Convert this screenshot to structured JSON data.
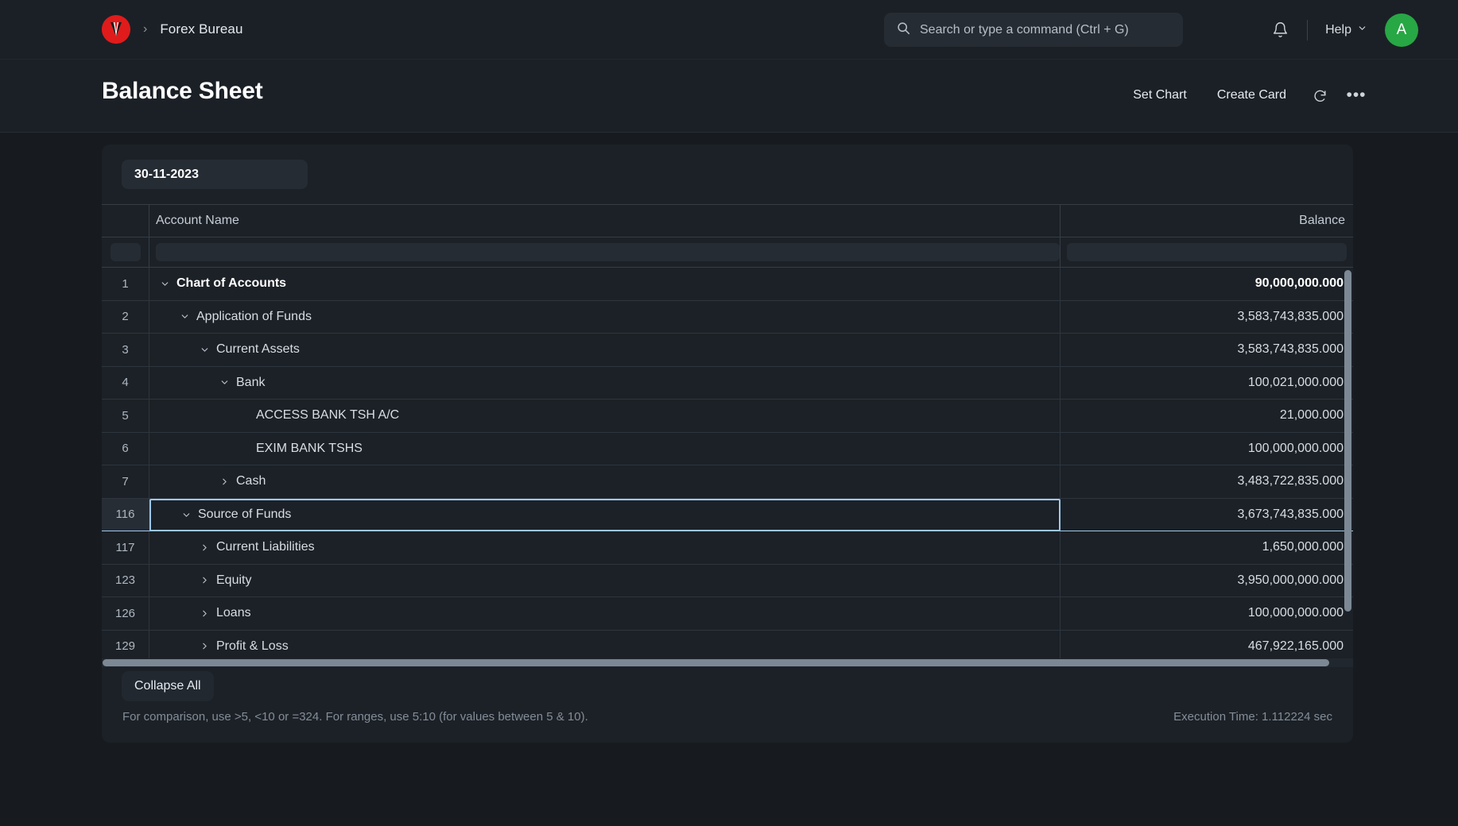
{
  "navbar": {
    "logo_icon": "vee-logo-icon",
    "breadcrumb_separator": "›",
    "breadcrumb_label": "Forex Bureau",
    "search": {
      "icon": "search-icon",
      "placeholder": "Search or type a command (Ctrl + G)",
      "value": ""
    },
    "bell_icon": "notification-bell-icon",
    "help_label": "Help",
    "help_chevron_icon": "chevron-down-icon",
    "avatar_initial": "A",
    "avatar_color": "#28a745"
  },
  "pagehead": {
    "title": "Balance Sheet",
    "actions": {
      "set_chart": "Set Chart",
      "create_card": "Create Card",
      "refresh_icon": "refresh-icon",
      "more_icon": "ellipsis-icon",
      "more_label": "•••"
    }
  },
  "filters": {
    "date_value": "30-11-2023"
  },
  "grid": {
    "columns": {
      "index": "",
      "account_name": "Account Name",
      "balance": "Balance"
    },
    "filter_row": {
      "account_name_value": "",
      "balance_value": ""
    },
    "rows": [
      {
        "idx": "1",
        "indent": 0,
        "chevron": "chevron-down-icon",
        "label": "Chart of Accounts",
        "balance": "90,000,000.000",
        "bold": true,
        "selected": false
      },
      {
        "idx": "2",
        "indent": 1,
        "chevron": "chevron-down-icon",
        "label": "Application of Funds",
        "balance": "3,583,743,835.000",
        "bold": false,
        "selected": false
      },
      {
        "idx": "3",
        "indent": 2,
        "chevron": "chevron-down-icon",
        "label": "Current Assets",
        "balance": "3,583,743,835.000",
        "bold": false,
        "selected": false
      },
      {
        "idx": "4",
        "indent": 3,
        "chevron": "chevron-down-icon",
        "label": "Bank",
        "balance": "100,021,000.000",
        "bold": false,
        "selected": false
      },
      {
        "idx": "5",
        "indent": 4,
        "chevron": "none",
        "label": "ACCESS BANK TSH A/C",
        "balance": "21,000.000",
        "bold": false,
        "selected": false
      },
      {
        "idx": "6",
        "indent": 4,
        "chevron": "none",
        "label": "EXIM BANK TSHS",
        "balance": "100,000,000.000",
        "bold": false,
        "selected": false
      },
      {
        "idx": "7",
        "indent": 3,
        "chevron": "chevron-right-icon",
        "label": "Cash",
        "balance": "3,483,722,835.000",
        "bold": false,
        "selected": false
      },
      {
        "idx": "116",
        "indent": 1,
        "chevron": "chevron-down-icon",
        "label": "Source of Funds",
        "balance": "3,673,743,835.000",
        "bold": false,
        "selected": true
      },
      {
        "idx": "117",
        "indent": 2,
        "chevron": "chevron-right-icon",
        "label": "Current Liabilities",
        "balance": "1,650,000.000",
        "bold": false,
        "selected": false
      },
      {
        "idx": "123",
        "indent": 2,
        "chevron": "chevron-right-icon",
        "label": "Equity",
        "balance": "3,950,000,000.000",
        "bold": false,
        "selected": false
      },
      {
        "idx": "126",
        "indent": 2,
        "chevron": "chevron-right-icon",
        "label": "Loans",
        "balance": "100,000,000.000",
        "bold": false,
        "selected": false
      },
      {
        "idx": "129",
        "indent": 2,
        "chevron": "chevron-right-icon",
        "label": "Profit & Loss",
        "balance": "467,922,165.000",
        "bold": false,
        "selected": false
      }
    ]
  },
  "footer": {
    "collapse_all": "Collapse All",
    "hint": "For comparison, use >5, <10 or =324. For ranges, use 5:10 (for values between 5 & 10).",
    "execution_time": "Execution Time: 1.112224 sec"
  },
  "colors": {
    "page_bg": "#171b20",
    "card_bg": "#1c2127",
    "nav_bg": "#1b2026",
    "accent_selection": "#9dc8ea",
    "brand_red": "#e01b1b",
    "avatar_green": "#28a745"
  }
}
